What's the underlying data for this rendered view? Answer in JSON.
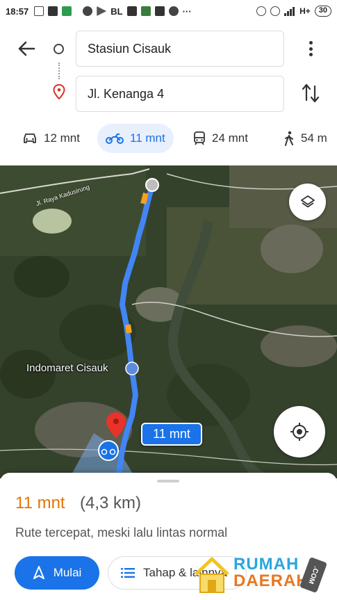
{
  "status_bar": {
    "time": "18:57",
    "bl": "BL",
    "network": "H+",
    "battery": "30"
  },
  "search": {
    "origin": "Stasiun Cisauk",
    "destination": "Jl. Kenanga 4"
  },
  "modes": [
    {
      "icon": "car-icon",
      "label": "12 mnt"
    },
    {
      "icon": "motorcycle-icon",
      "label": "11 mnt",
      "selected": true
    },
    {
      "icon": "transit-icon",
      "label": "24 mnt"
    },
    {
      "icon": "walk-icon",
      "label": "54 m"
    }
  ],
  "map": {
    "road_label": "Jl. Raya Kadusirung",
    "place_label": "Indomaret Cisauk",
    "route_time": "11 mnt",
    "route_color": "#4285f4",
    "traffic_color": "#f4a020"
  },
  "route_summary": {
    "duration": "11 mnt",
    "distance": "(4,3 km)",
    "description": "Rute tercepat, meski lalu lintas normal",
    "start_button": "Mulai",
    "steps_button": "Tahap & lainnya"
  },
  "watermark": {
    "line1": "RUMAH",
    "line2": "DAERAH",
    "badge": ".COM"
  },
  "colors": {
    "accent": "#1a73e8",
    "duration": "#e37400"
  }
}
